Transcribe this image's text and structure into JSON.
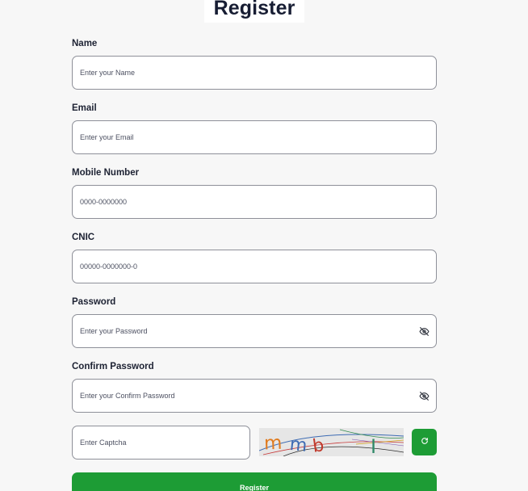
{
  "header": {
    "title": "Register"
  },
  "form": {
    "name": {
      "label": "Name",
      "placeholder": "Enter your Name"
    },
    "email": {
      "label": "Email",
      "placeholder": "Enter your Email"
    },
    "mobile": {
      "label": "Mobile Number",
      "placeholder": "0000-0000000"
    },
    "cnic": {
      "label": "CNIC",
      "placeholder": "00000-0000000-0"
    },
    "password": {
      "label": "Password",
      "placeholder": "Enter your Password",
      "toggle_icon": "eye-off-icon"
    },
    "confirm_password": {
      "label": "Confirm Password",
      "placeholder": "Enter your Confirm Password",
      "toggle_icon": "eye-off-icon"
    },
    "captcha": {
      "placeholder": "Enter Captcha",
      "image_text": "mmb I",
      "refresh_icon": "refresh-icon"
    },
    "submit_label": "Register"
  },
  "colors": {
    "accent": "#1d9c35",
    "title": "#171d33",
    "border": "#8e9099",
    "background": "#f7f7f7"
  }
}
